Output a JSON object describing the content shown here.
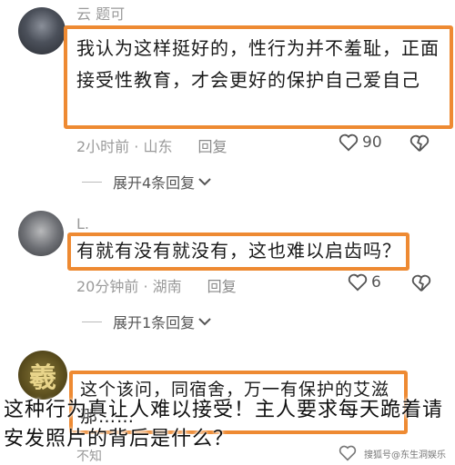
{
  "comments": [
    {
      "username": "云 题可",
      "text": "我认为这样挺好的，性行为并不羞耻，正面接受性教育，才会更好的保护自己爱自己",
      "time": "2小时前 · 山东",
      "reply": "回复",
      "likes": "90",
      "expand": "展开4条回复"
    },
    {
      "username": "L.",
      "text": "有就有没有就没有，这也难以启齿吗？",
      "time": "20分钟前 · 湖南",
      "reply": "回复",
      "likes": "6",
      "expand": "展开1条回复"
    },
    {
      "username": "",
      "avatar_char": "羲",
      "text": "这个该问，同宿舍，万一有保护的艾滋那……",
      "time": "不知"
    }
  ],
  "overlay": {
    "title": "这种行为真让人难以接受！主人要求每天跪着请安发照片的背后是什么？"
  },
  "watermark": "搜狐号@东生洞娱乐",
  "colors": {
    "highlight": "#ee8a32",
    "meta": "#9a9a9a"
  }
}
